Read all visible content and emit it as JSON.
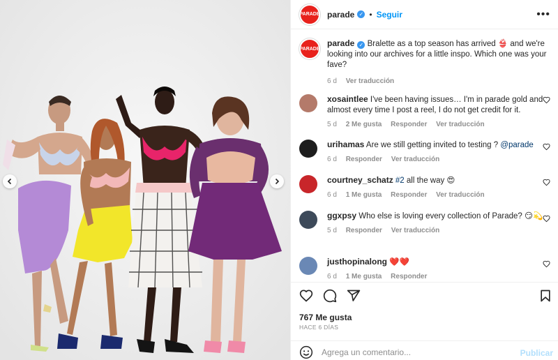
{
  "post": {
    "username": "parade",
    "follow_label": "Seguir",
    "avatar_text": "PARADE",
    "caption": "Bralette as a top season has arrived 👙 and we're looking into our archives for a little inspo. Which one was your fave?",
    "caption_time": "6 d",
    "caption_translate": "Ver traducción"
  },
  "comments": [
    {
      "username": "xosaintlee",
      "text": "I've been having issues… I'm in parade gold and almost every time I post a reel, I do not get credit for it.",
      "time": "5 d",
      "likes": "2 Me gusta",
      "reply": "Responder",
      "translate": "Ver traducción",
      "avatar_color": "#b47a6a"
    },
    {
      "username": "urihamas",
      "text": "Are we still getting invited to testing ?",
      "mention": "@parade",
      "time": "6 d",
      "reply": "Responder",
      "translate": "Ver traducción",
      "avatar_color": "#1d1d1d"
    },
    {
      "username": "courtney_schatz",
      "hashtag": "#2",
      "text": "all the way 😍",
      "time": "6 d",
      "likes": "1 Me gusta",
      "reply": "Responder",
      "translate": "Ver traducción",
      "avatar_color": "#c8262a"
    },
    {
      "username": "ggxpsy",
      "text": "Who else is loving every collection of Parade? 😏💫",
      "time": "5 d",
      "reply": "Responder",
      "translate": "Ver traducción",
      "avatar_color": "#3d4a5a"
    },
    {
      "username": "justhopinalong",
      "text": "❤️❤️",
      "time": "6 d",
      "likes": "1 Me gusta",
      "reply": "Responder",
      "avatar_color": "#6a88b5"
    }
  ],
  "footer": {
    "likes": "767 Me gusta",
    "date": "HACE 6 DÍAS",
    "comment_placeholder": "Agrega un comentario...",
    "publish_label": "Publicar"
  },
  "icons": {
    "like": "heart-icon",
    "comment": "comment-icon",
    "share": "send-icon",
    "save": "bookmark-icon",
    "emoji": "emoji-icon",
    "more": "more-options-icon",
    "prev": "chevron-left-icon",
    "next": "chevron-right-icon"
  },
  "colors": {
    "accent": "#0095f6",
    "brand": "#e8211c",
    "muted": "#8e8e8e"
  }
}
